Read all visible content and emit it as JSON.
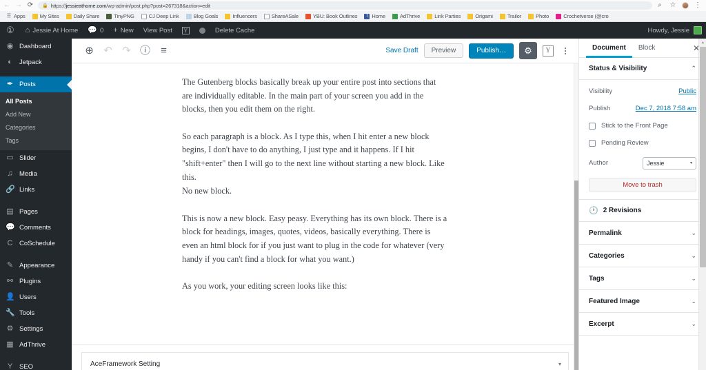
{
  "browser": {
    "url_prefix": "https://",
    "url_domain": "jessieathome.com",
    "url_path": "/wp-admin/post.php?post=267318&action=edit",
    "back_icon": "←",
    "forward_icon": "→",
    "reload_icon": "⟳",
    "lock_icon": "🔒",
    "zoom_icon": "⌕",
    "star_icon": "☆",
    "menu_icon": "⋮",
    "bookmarks": [
      {
        "label": "Apps",
        "icon": "apps-grid-icon",
        "cls": "ico-apps",
        "glyph": "⠿"
      },
      {
        "label": "My Sites",
        "icon": "folder-icon",
        "cls": "ico-folder",
        "glyph": ""
      },
      {
        "label": "Daily Share",
        "icon": "folder-icon",
        "cls": "ico-folder",
        "glyph": ""
      },
      {
        "label": "TinyPNG",
        "icon": "tinypng-icon",
        "cls": "ico-tinypng",
        "glyph": ""
      },
      {
        "label": "CJ Deep Link",
        "icon": "page-icon",
        "cls": "ico-page",
        "glyph": ""
      },
      {
        "label": "Blog Goals",
        "icon": "blog-goals-icon",
        "cls": "ico-blog",
        "glyph": ""
      },
      {
        "label": "Influencers",
        "icon": "folder-icon",
        "cls": "ico-folder",
        "glyph": ""
      },
      {
        "label": "ShareASale",
        "icon": "page-icon",
        "cls": "ico-page",
        "glyph": ""
      },
      {
        "label": "YBU: Book Outlines",
        "icon": "ybu-icon",
        "cls": "ico-ybu",
        "glyph": ""
      },
      {
        "label": "Home",
        "icon": "facebook-icon",
        "cls": "ico-fb",
        "glyph": "f"
      },
      {
        "label": "AdThrive",
        "icon": "adthrive-icon",
        "cls": "ico-adthrive",
        "glyph": ""
      },
      {
        "label": "Link Parties",
        "icon": "folder-icon",
        "cls": "ico-folder",
        "glyph": ""
      },
      {
        "label": "Origami",
        "icon": "folder-icon",
        "cls": "ico-folder",
        "glyph": ""
      },
      {
        "label": "Trailor",
        "icon": "folder-icon",
        "cls": "ico-folder",
        "glyph": ""
      },
      {
        "label": "Photo",
        "icon": "folder-icon",
        "cls": "ico-folder",
        "glyph": ""
      },
      {
        "label": "Crochetverse (@cro",
        "icon": "crochetverse-icon",
        "cls": "ico-crochet",
        "glyph": ""
      }
    ]
  },
  "adminbar": {
    "logo_icon": "wordpress-logo-icon",
    "site_name": "Jessie At Home",
    "site_icon": "home-icon",
    "comments_icon": "comment-bubble-icon",
    "comments_count": "0",
    "new_icon": "plus-icon",
    "new_label": "New",
    "view_post_label": "View Post",
    "yoast_icon": "yoast-icon",
    "yoast_glyph": "Y",
    "status_dot_icon": "gray-circle-icon",
    "delete_cache_label": "Delete Cache",
    "howdy": "Howdy, Jessie",
    "avatar_name": "avatar"
  },
  "sidebar": {
    "items": [
      {
        "label": "Dashboard",
        "icon": "dashboard-icon",
        "glyph": "◉",
        "current": false,
        "gap_before": false
      },
      {
        "label": "Jetpack",
        "icon": "jetpack-icon",
        "glyph": "◐",
        "current": false,
        "gap_before": false
      },
      {
        "label": "Posts",
        "icon": "pin-icon",
        "glyph": "✒",
        "current": true,
        "gap_before": true
      }
    ],
    "submenu": [
      {
        "label": "All Posts",
        "current": true
      },
      {
        "label": "Add New",
        "current": false
      },
      {
        "label": "Categories",
        "current": false
      },
      {
        "label": "Tags",
        "current": false
      }
    ],
    "items2": [
      {
        "label": "Slider",
        "icon": "slider-icon",
        "glyph": "▭",
        "gap_before": false
      },
      {
        "label": "Media",
        "icon": "media-icon",
        "glyph": "♫",
        "gap_before": false
      },
      {
        "label": "Links",
        "icon": "link-icon",
        "glyph": "🔗",
        "gap_before": false
      },
      {
        "label": "Pages",
        "icon": "pages-icon",
        "glyph": "▤",
        "gap_before": true
      },
      {
        "label": "Comments",
        "icon": "comment-bubble-icon",
        "glyph": "💬",
        "gap_before": false
      },
      {
        "label": "CoSchedule",
        "icon": "coschedule-icon",
        "glyph": "C",
        "gap_before": false
      },
      {
        "label": "Appearance",
        "icon": "paintbrush-icon",
        "glyph": "✎",
        "gap_before": true
      },
      {
        "label": "Plugins",
        "icon": "plug-icon",
        "glyph": "⚯",
        "gap_before": false
      },
      {
        "label": "Users",
        "icon": "user-icon",
        "glyph": "👤",
        "gap_before": false
      },
      {
        "label": "Tools",
        "icon": "wrench-icon",
        "glyph": "🔧",
        "gap_before": false
      },
      {
        "label": "Settings",
        "icon": "settings-sliders-icon",
        "glyph": "⚙",
        "gap_before": false
      },
      {
        "label": "AdThrive",
        "icon": "adthrive-icon",
        "glyph": "▦",
        "gap_before": false
      },
      {
        "label": "SEO",
        "icon": "yoast-seo-icon",
        "glyph": "Y",
        "gap_before": true
      }
    ]
  },
  "editor_header": {
    "add_block_icon": "plus-circle-icon",
    "undo_icon": "undo-arrow-icon",
    "redo_icon": "redo-arrow-icon",
    "info_icon": "info-circle-icon",
    "block_nav_icon": "block-navigation-icon",
    "save_draft_label": "Save Draft",
    "preview_label": "Preview",
    "publish_label": "Publish…",
    "gear_icon": "gear-icon",
    "yoast_icon": "yoast-icon",
    "yoast_glyph": "Y",
    "more_icon": "kebab-menu-icon"
  },
  "post": {
    "paragraphs": [
      "The Gutenberg blocks basically break up your entire post into sections that are individually editable. In the main part of your screen you add in the blocks, then you edit them on the right.",
      "So each paragraph is a block. As I type this, when I hit enter a new block begins, I don't have to do anything, I just type and it happens. If I hit \"shift+enter\" then I will go to the next line without starting a new block. Like this.",
      "No new block.",
      "This is now a new block. Easy peasy. Everything has its own block. There is a block for headings, images, quotes, videos, basically everything. There is even an html block for if you just want to plug in the code for whatever (very handy if you can't find a block for what you want.)",
      "As you work, your editing screen looks like this:"
    ]
  },
  "meta_box": {
    "title": "AceFramework Setting",
    "toggle_icon": "chevron-down-icon",
    "toggle_glyph": "▾"
  },
  "settings": {
    "tabs": [
      {
        "label": "Document",
        "active": true
      },
      {
        "label": "Block",
        "active": false
      }
    ],
    "close_icon": "close-icon",
    "close_glyph": "✕",
    "status_panel": {
      "title": "Status & Visibility",
      "chevron_glyph": "⌃",
      "visibility_label": "Visibility",
      "visibility_value": "Public",
      "publish_label": "Publish",
      "publish_value": "Dec 7, 2018 7:58 am",
      "sticky_label": "Stick to the Front Page",
      "pending_label": "Pending Review",
      "author_label": "Author",
      "author_value": "Jessie",
      "author_caret": "▾",
      "trash_label": "Move to trash"
    },
    "revisions": {
      "icon": "clock-revisions-icon",
      "glyph": "🕐",
      "label": "2 Revisions"
    },
    "panels": [
      {
        "label": "Permalink",
        "chevron_glyph": "⌄"
      },
      {
        "label": "Categories",
        "chevron_glyph": "⌄"
      },
      {
        "label": "Tags",
        "chevron_glyph": "⌄"
      },
      {
        "label": "Featured Image",
        "chevron_glyph": "⌄"
      },
      {
        "label": "Excerpt",
        "chevron_glyph": "⌄"
      }
    ],
    "scroll_up_glyph": "▴",
    "scroll_down_glyph": "▾"
  },
  "colors": {
    "wp_blue": "#0073aa",
    "publish_blue": "#0085ba",
    "adminbar": "#23282d",
    "submenu": "#32373c",
    "accent_tab": "#00a0d2",
    "trash_red": "#b52727"
  }
}
